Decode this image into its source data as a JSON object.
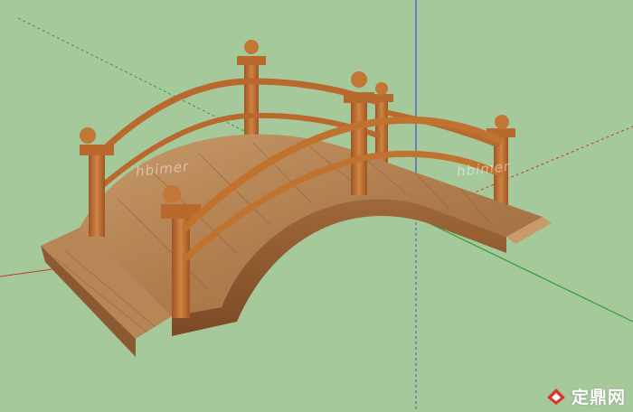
{
  "scene": {
    "subject": "wooden-arched-footbridge",
    "colors": {
      "background": "#a6c99b",
      "deck_light": "#c79a6a",
      "deck_mid": "#b07d4e",
      "deck_dark": "#8c5a32",
      "rail": "#b9692d",
      "rail_dark": "#8b4a1c",
      "post": "#c07436",
      "axis_red": "#c0392b",
      "axis_green": "#2e9e3c",
      "axis_blue": "#3a4fd6"
    }
  },
  "watermarks": [
    "hbimer",
    "hbimer"
  ],
  "logo": {
    "text": "定鼎网",
    "accent": "#d23a2a"
  }
}
